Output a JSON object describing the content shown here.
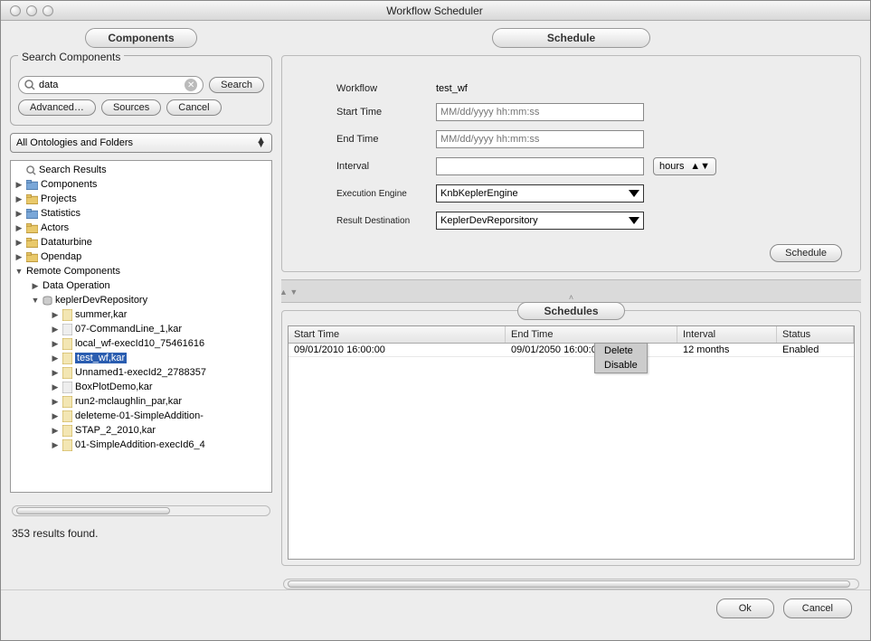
{
  "window": {
    "title": "Workflow Scheduler"
  },
  "left": {
    "tab": "Components",
    "search_group": "Search Components",
    "search_value": "data",
    "btn_search": "Search",
    "btn_advanced": "Advanced…",
    "btn_sources": "Sources",
    "btn_cancel": "Cancel",
    "combo": "All Ontologies and Folders",
    "status": "353 results found.",
    "tree": {
      "search_results": "Search Results",
      "components": "Components",
      "projects": "Projects",
      "statistics": "Statistics",
      "actors": "Actors",
      "dataturbine": "Dataturbine",
      "opendap": "Opendap",
      "remote": "Remote Components",
      "data_operation": "Data Operation",
      "repo": "keplerDevRepository",
      "files": {
        "f0": "summer,kar",
        "f1": "07-CommandLine_1,kar",
        "f2": "local_wf-execId10_75461616",
        "f3": "test_wf,kar",
        "f4": "Unnamed1-execId2_2788357",
        "f5": "BoxPlotDemo,kar",
        "f6": "run2-mclaughlin_par,kar",
        "f7": "deleteme-01-SimpleAddition-",
        "f8": "STAP_2_2010,kar",
        "f9": "01-SimpleAddition-execId6_4"
      }
    }
  },
  "right": {
    "tab": "Schedule",
    "labels": {
      "workflow": "Workflow",
      "start": "Start Time",
      "end": "End Time",
      "interval": "Interval",
      "engine": "Execution Engine",
      "dest": "Result  Destination"
    },
    "workflow_name": "test_wf",
    "placeholder_time": "MM/dd/yyyy hh:mm:ss",
    "interval_unit": "hours",
    "engine": "KnbKeplerEngine",
    "destination": "KeplerDevReporsitory",
    "btn_schedule": "Schedule",
    "schedules_tab": "Schedules",
    "columns": {
      "c0": "Start Time",
      "c1": "End Time",
      "c2": "Interval",
      "c3": "Status"
    },
    "row": {
      "start": "09/01/2010 16:00:00",
      "end": "09/01/2050 16:00:00",
      "interval": "12 months",
      "status": "Enabled"
    },
    "ctx": {
      "delete": "Delete",
      "disable": "Disable"
    }
  },
  "footer": {
    "ok": "Ok",
    "cancel": "Cancel"
  }
}
